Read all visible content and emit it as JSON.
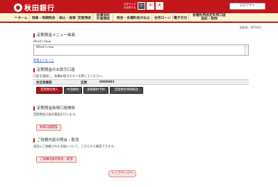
{
  "header": {
    "bank_name": "秋田銀行",
    "font_size_label": "文字サイズを変更する",
    "font_sizes": [
      "小",
      "中",
      "大"
    ],
    "logout_label": "ログアウト"
  },
  "nav": {
    "items": [
      {
        "label": "ホーム"
      },
      {
        "label": "残高・明細照会"
      },
      {
        "label": "振込・振替"
      },
      {
        "label": "定期預金"
      },
      {
        "label": "投資信託外貨預金"
      },
      {
        "label": "税金・各種料金の払込"
      },
      {
        "label": "住宅ローン"
      },
      {
        "label": "電子交付"
      },
      {
        "label": "各種利用設定利用口座追加・削除"
      }
    ]
  },
  "screen_id": "画面ID：BFT002",
  "menu": {
    "title": "定期預金メニュー画面",
    "whats_new_label": "What's New",
    "whats_new_content": "What's new",
    "more_link": "新着よりもっと"
  },
  "accounts": {
    "title": "定期預金のお取引口座",
    "instruction": "口座を選択し、各種お取引ボタンを押してください。",
    "row": {
      "branch": "本店営業部",
      "type": "定期",
      "number": "0000001"
    },
    "buttons": [
      {
        "label": "定期預金預入"
      },
      {
        "label": "中途解約"
      },
      {
        "label": "満期解約予約"
      },
      {
        "label": "定期預金明細照会"
      }
    ]
  },
  "new_account": {
    "title": "定期預金新規口座開設",
    "description": "定期預金口座の開設を行います。",
    "button": "新規口座開設"
  },
  "inquiry": {
    "title": "ご依頼内容の照会・取消",
    "description": "過去にご依頼された内容について、こちらから確認できます。",
    "button": "ご依頼内容の照会・取消"
  },
  "top_button": "トップページへ"
}
